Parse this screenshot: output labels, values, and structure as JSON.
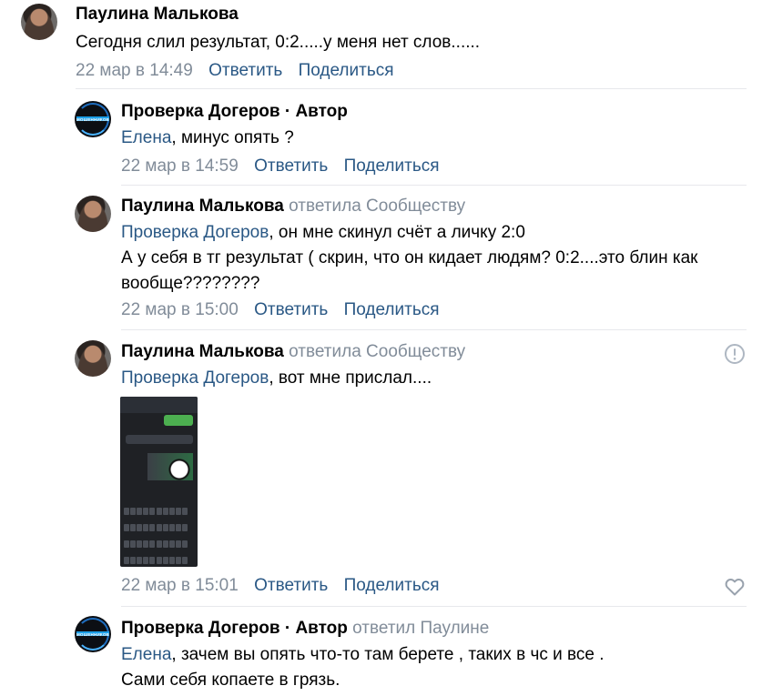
{
  "comments": [
    {
      "author": "Паулина Малькова",
      "text": "Сегодня слил результат, 0:2.....у меня нет слов......",
      "date": "22 мар в 14:49",
      "reply": "Ответить",
      "share": "Поделиться"
    },
    {
      "author": "Проверка Догеров · Автор",
      "mention": "Елена",
      "text": ", минус опять ?",
      "date": "22 мар в 14:59",
      "reply": "Ответить",
      "share": "Поделиться",
      "avatar_text": "МОШЕННИКОВ"
    },
    {
      "author": "Паулина Малькова",
      "replied": "ответила Сообществу",
      "mention": "Проверка Догеров",
      "text_line1": ", он мне скинул счёт а личку 2:0",
      "text_line2": "А у себя в тг результат ( скрин, что он кидает людям? 0:2....это блин как",
      "text_line3": "вообще????????",
      "date": "22 мар в 15:00",
      "reply": "Ответить",
      "share": "Поделиться"
    },
    {
      "author": "Паулина Малькова",
      "replied": "ответила Сообществу",
      "mention": "Проверка Догеров",
      "text": ", вот мне прислал....",
      "date": "22 мар в 15:01",
      "reply": "Ответить",
      "share": "Поделиться"
    },
    {
      "author": "Проверка Догеров · Автор",
      "replied": "ответил Паулине",
      "mention": "Елена",
      "text_line1": ", зачем вы опять что-то там берете , таких в чс и все .",
      "text_line2": "Сами себя копаете в грязь.",
      "avatar_text": "МОШЕННИКОВ"
    }
  ]
}
